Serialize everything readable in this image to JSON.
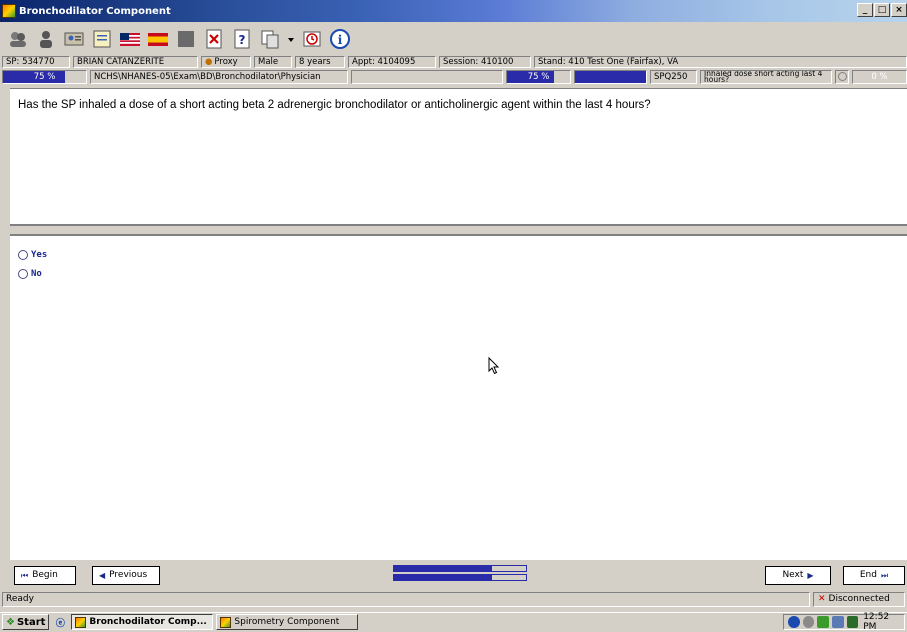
{
  "window": {
    "title": "Bronchodilator Component",
    "controls": [
      "_",
      "□",
      "×"
    ]
  },
  "toolbar": {
    "icons": [
      "users-icon",
      "person-icon",
      "id-card-icon",
      "notepad-icon",
      "us-flag-icon",
      "spain-flag-icon",
      "gray-square-icon",
      "cancel-doc-icon",
      "help-doc-icon",
      "copy-icon",
      "dropdown-arrow-icon",
      "alarm-icon",
      "info-icon"
    ]
  },
  "info": {
    "sp": "SP: 534770",
    "name": "BRIAN CATANZERITE",
    "proxy": "Proxy",
    "sex": "Male",
    "age": "8 years",
    "appt": "Appt: 4104095",
    "session": "Session: 410100",
    "stand": "Stand: 410 Test One (Fairfax), VA"
  },
  "progress": {
    "left_pct_label": "75 %",
    "left_fraction": 0.75,
    "path": "NCHS\\NHANES-05\\Exam\\BD\\Bronchodilator\\Physician",
    "mid_pct_label": "75 %",
    "mid_fraction": 0.75,
    "code": "SPQ250",
    "short_question": "Inhaled dose short acting last 4 hours?",
    "right_pct_label": "0 %",
    "right_fraction": 0
  },
  "question": {
    "text": "Has the SP inhaled a dose of a short acting beta 2 adrenergic bronchodilator or anticholinergic agent within the last 4 hours?"
  },
  "answers": [
    {
      "label": "Yes"
    },
    {
      "label": "No"
    }
  ],
  "nav": {
    "begin": "Begin",
    "previous": "Previous",
    "next": "Next",
    "end": "End",
    "progress_top_fraction": 0.74,
    "progress_bottom_fraction": 0.74
  },
  "status": {
    "left": "Ready",
    "right": "Disconnected"
  },
  "taskbar": {
    "start": "Start",
    "tasks": [
      {
        "label": "Bronchodilator Comp...",
        "active": true
      },
      {
        "label": "Spirometry Component",
        "active": false
      }
    ],
    "time": "12:52 PM"
  }
}
